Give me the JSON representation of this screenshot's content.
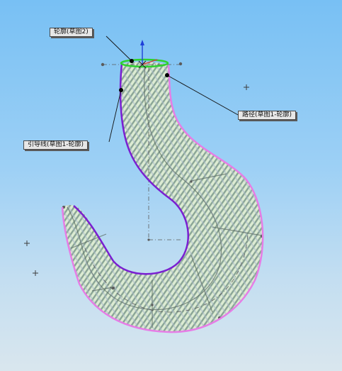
{
  "viewport": {
    "background_top": "#78c0f4",
    "background_bottom": "#d9e6ee"
  },
  "callouts": {
    "profile": "轮廓(草图2)",
    "path": "路径(草图1-轮廓)",
    "guide": "引导线(草图1-轮廓)"
  },
  "colors": {
    "path_curve": "#e67de6",
    "guide_curve": "#7a1fd1",
    "profile_curve": "#2ed12e",
    "surface_fill": "#d9ead0",
    "surface_stripe": "#7f9a8c",
    "origin_axis": "#1f3fd9"
  },
  "icons": {
    "origin": "origin-triad-icon",
    "reference_point": "plus-marker-icon"
  }
}
